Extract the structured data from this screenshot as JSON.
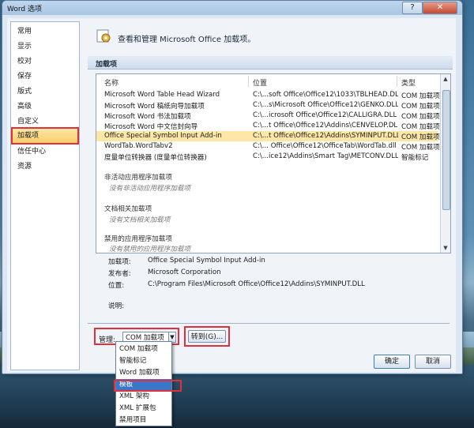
{
  "window": {
    "title": "Word 选项",
    "help_icon": "?",
    "close_icon": "✕"
  },
  "nav": {
    "items": [
      {
        "label": "常用"
      },
      {
        "label": "显示"
      },
      {
        "label": "校对"
      },
      {
        "label": "保存"
      },
      {
        "label": "版式"
      },
      {
        "label": "高级"
      },
      {
        "label": "自定义"
      },
      {
        "label": "加载项",
        "selected": true
      },
      {
        "label": "信任中心"
      },
      {
        "label": "资源"
      }
    ]
  },
  "header": {
    "text": "查看和管理 Microsoft Office 加载项。",
    "icon": "addins-gear-icon"
  },
  "section": {
    "title": "加载项"
  },
  "list": {
    "columns": {
      "name": "名称",
      "location": "位置",
      "type": "类型"
    },
    "rows": [
      {
        "name": "Microsoft Word Table Head Wizard",
        "location": "C:\\...soft Office\\Office12\\1033\\TBLHEAD.DLL",
        "type": "COM 加载项"
      },
      {
        "name": "Microsoft Word 稿纸向导加载项",
        "location": "C:\\...s\\Microsoft Office\\Office12\\GENKO.DLL",
        "type": "COM 加载项"
      },
      {
        "name": "Microsoft Word 书法加载项",
        "location": "C:\\...icrosoft Office\\Office12\\CALLIGRA.DLL",
        "type": "COM 加载项"
      },
      {
        "name": "Microsoft Word 中文信封向导",
        "location": "C:\\...t Office\\Office12\\Addins\\CENVELOP.DLL",
        "type": "COM 加载项"
      },
      {
        "name": "Office Special Symbol Input Add-in",
        "location": "C:\\...t Office\\Office12\\Addins\\SYMINPUT.DLL",
        "type": "COM 加载项",
        "highlighted": true
      },
      {
        "name": "WordTab.WordTabv2",
        "location": "C:\\... Office\\Office12\\OfficeTab\\WordTab.dll",
        "type": "COM 加载项"
      },
      {
        "name": "度量单位转换器 (度量单位转换器)",
        "location": "C:\\...ice12\\Addins\\Smart Tag\\METCONV.DLL",
        "type": "智能标记"
      }
    ],
    "groups": [
      {
        "title": "非活动应用程序加载项",
        "empty_text": "没有非活动应用程序加载项"
      },
      {
        "title": "文档相关加载项",
        "empty_text": "没有文档相关加载项"
      },
      {
        "title": "禁用的应用程序加载项",
        "empty_text": "没有禁用的应用程序加载项"
      }
    ]
  },
  "details": {
    "addin_label": "加载项:",
    "addin_value": "Office Special Symbol Input Add-in",
    "publisher_label": "发布者:",
    "publisher_value": "Microsoft Corporation",
    "location_label": "位置:",
    "location_value": "C:\\Program Files\\Microsoft Office\\Office12\\Addins\\SYMINPUT.DLL",
    "description_label": "说明:"
  },
  "manage": {
    "label": "管理:",
    "selected": "COM 加载项",
    "goto_label": "转到(G)...",
    "options": [
      "COM 加载项",
      "智能标记",
      "Word 加载项",
      "模板",
      "XML 架构",
      "XML 扩展包",
      "禁用项目"
    ],
    "highlighted_option": "模板"
  },
  "footer": {
    "ok_label": "确定",
    "cancel_label": "取消"
  }
}
